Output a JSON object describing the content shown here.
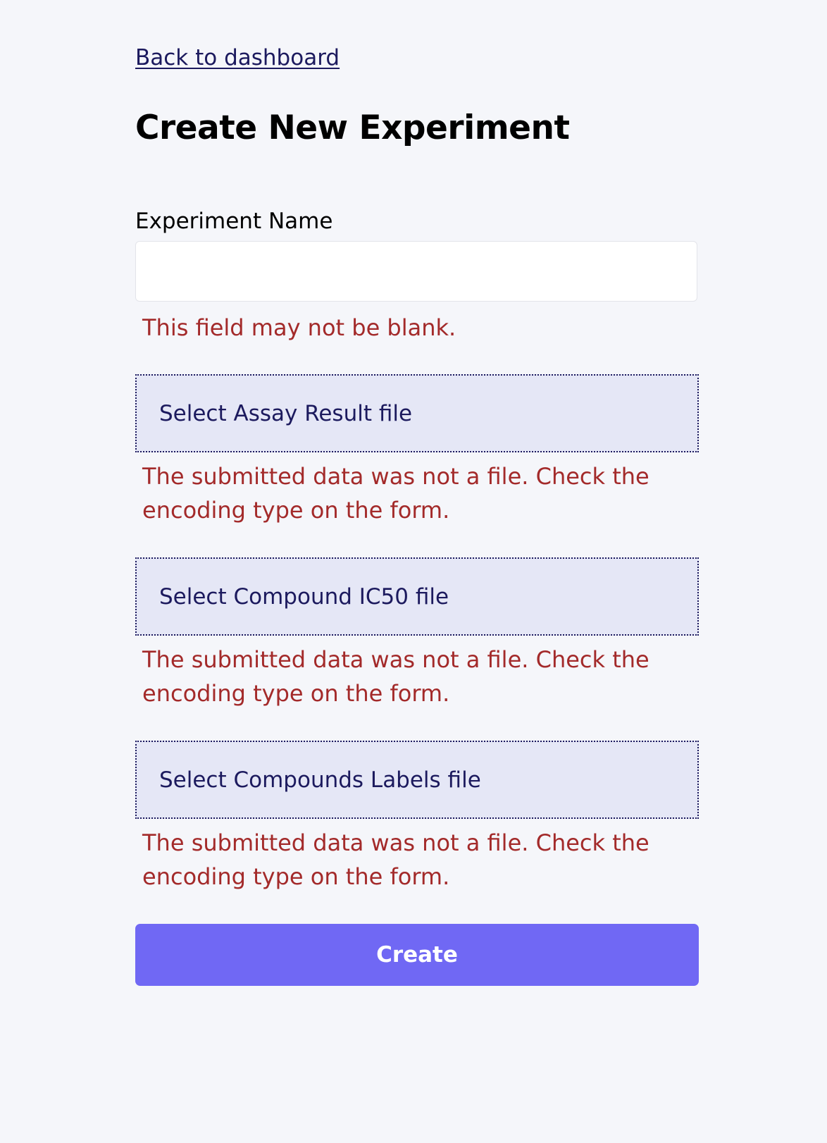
{
  "nav": {
    "back_label": "Back to dashboard"
  },
  "page": {
    "title": "Create New Experiment"
  },
  "form": {
    "experiment_name": {
      "label": "Experiment Name",
      "value": "",
      "error": "This field may not be blank."
    },
    "files": [
      {
        "label": "Select Assay Result file",
        "error": "The submitted data was not a file. Check the encoding type on the form."
      },
      {
        "label": "Select Compound IC50 file",
        "error": "The submitted data was not a file. Check the encoding type on the form."
      },
      {
        "label": "Select Compounds Labels file",
        "error": "The submitted data was not a file. Check the encoding type on the form."
      }
    ],
    "submit_label": "Create"
  },
  "colors": {
    "background": "#f5f6fa",
    "link": "#1c1a5e",
    "error": "#a32a2a",
    "file_box_bg": "#e5e7f6",
    "button": "#7068f4"
  }
}
